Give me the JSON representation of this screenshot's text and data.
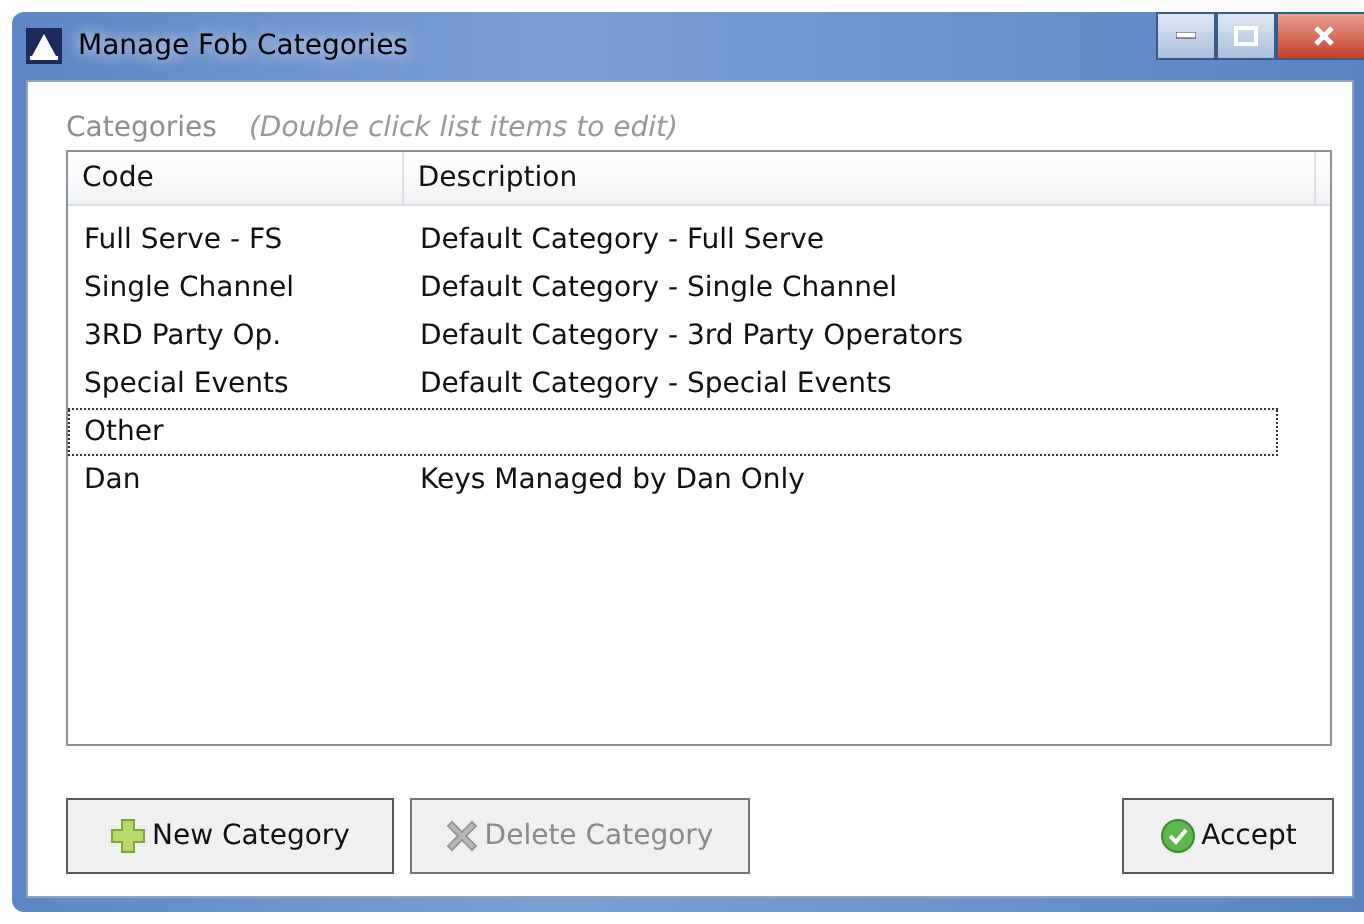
{
  "window": {
    "title": "Manage Fob Categories"
  },
  "categories": {
    "label": "Categories",
    "hint": "(Double click list items to edit)"
  },
  "table": {
    "columns": [
      "Code",
      "Description"
    ],
    "rows": [
      {
        "code": "Full Serve - FS",
        "description": "Default Category - Full Serve",
        "focused": false
      },
      {
        "code": "Single Channel",
        "description": "Default Category - Single Channel",
        "focused": false
      },
      {
        "code": "3RD Party Op.",
        "description": "Default Category - 3rd Party Operators",
        "focused": false
      },
      {
        "code": "Special Events",
        "description": "Default Category - Special Events",
        "focused": false
      },
      {
        "code": "Other",
        "focused": true
      },
      {
        "code": "Dan",
        "description": "Keys Managed by Dan Only",
        "focused": false
      }
    ]
  },
  "buttons": [
    {
      "kind": "add",
      "label": "New Category",
      "disabled": false
    },
    {
      "kind": "delete",
      "label": "Delete Category",
      "disabled": true
    },
    {
      "kind": "accept",
      "label": "Accept",
      "disabled": false
    }
  ]
}
